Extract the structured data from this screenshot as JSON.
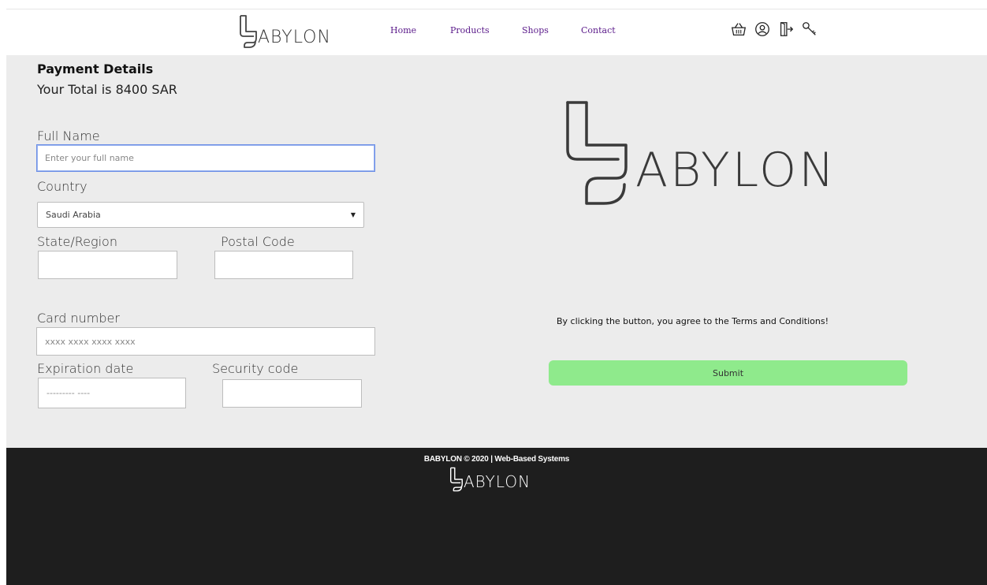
{
  "header": {
    "brand": "ABYLON",
    "nav": [
      "Home",
      "Products",
      "Shops",
      "Contact"
    ],
    "icons": [
      "basket-icon",
      "user-icon",
      "logout-icon",
      "key-icon"
    ]
  },
  "form": {
    "heading": "Payment Details",
    "total": "Your Total is 8400 SAR",
    "full_name_label": "Full Name",
    "full_name_placeholder": "Enter your full name",
    "country_label": "Country",
    "country_value": "Saudi Arabia",
    "state_label": "State/Region",
    "postal_label": "Postal Code",
    "card_label": "Card number",
    "card_placeholder": "xxxx xxxx xxxx xxxx",
    "exp_label": "Expiration date",
    "exp_placeholder": "--------- ----",
    "security_label": "Security code"
  },
  "side": {
    "brand": "ABYLON",
    "terms": "By clicking the button, you agree to the Terms and Conditions!",
    "submit": "Submit"
  },
  "footer": {
    "copyright": "BABYLON © 2020 | Web-Based Systems",
    "brand": "ABYLON"
  },
  "colors": {
    "submit_bg": "#8fea8c",
    "main_bg": "#ececec",
    "footer_bg": "#1e1e1e",
    "nav_link": "#5a1a8a"
  }
}
